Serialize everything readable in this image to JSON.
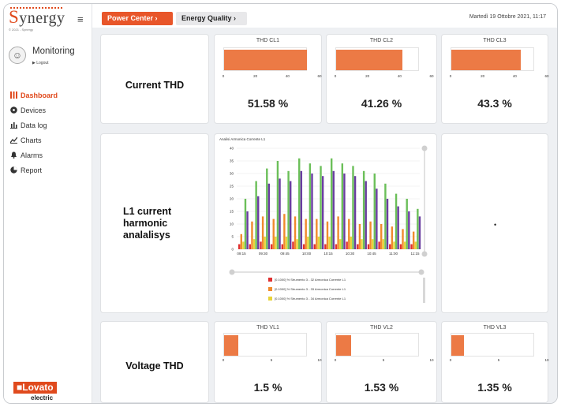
{
  "app": {
    "logo_text": "Synergy",
    "copyright": "© 2021 - Synergy",
    "menu_icon": "hamburger-icon"
  },
  "user": {
    "name": "Monitoring",
    "logout": "Logout"
  },
  "nav": [
    {
      "label": "Dashboard",
      "icon": "grid-icon",
      "active": true
    },
    {
      "label": "Devices",
      "icon": "gauge-icon",
      "active": false
    },
    {
      "label": "Data log",
      "icon": "bar-chart-icon",
      "active": false
    },
    {
      "label": "Charts",
      "icon": "line-chart-icon",
      "active": false
    },
    {
      "label": "Alarms",
      "icon": "bell-icon",
      "active": false
    },
    {
      "label": "Report",
      "icon": "pie-icon",
      "active": false
    }
  ],
  "brand": {
    "name": "Lovato",
    "sub": "electric"
  },
  "breadcrumb": {
    "first": "Power Center ›",
    "second": "Energy Quality ›"
  },
  "datetime": "Martedì 19 Ottobre 2021, 11:17",
  "sections": {
    "current_thd": "Current THD",
    "harmonic": [
      "L1 current",
      "harmonic",
      "analalisys"
    ],
    "voltage_thd": "Voltage THD",
    "placeholder_dot": "•"
  },
  "current_cards": [
    {
      "title": "THD CL1",
      "value_text": "51.58 %",
      "value": 51.58,
      "max": 60,
      "ticks": [
        "0",
        "20",
        "40",
        "60"
      ]
    },
    {
      "title": "THD CL2",
      "value_text": "41.26 %",
      "value": 41.26,
      "max": 60,
      "ticks": [
        "0",
        "20",
        "40",
        "60"
      ]
    },
    {
      "title": "THD CL3",
      "value_text": "43.3 %",
      "value": 43.3,
      "max": 60,
      "ticks": [
        "0",
        "20",
        "40",
        "60"
      ]
    }
  ],
  "voltage_cards": [
    {
      "title": "THD VL1",
      "value_text": "1.5 %",
      "value": 1.5,
      "max": 10,
      "ticks": [
        "0",
        "5",
        "10"
      ]
    },
    {
      "title": "THD VL2",
      "value_text": "1.53 %",
      "value": 1.53,
      "max": 10,
      "ticks": [
        "0",
        "5",
        "10"
      ]
    },
    {
      "title": "THD VL3",
      "value_text": "1.35 %",
      "value": 1.35,
      "max": 10,
      "ticks": [
        "0",
        "5",
        "10"
      ]
    }
  ],
  "colors": {
    "accent": "#e8562a",
    "bar": "#ec7a45"
  },
  "chart_data": {
    "type": "bar",
    "title": "Analisi Armonica Corrente L1",
    "ylim": [
      0,
      40
    ],
    "yticks": [
      "0",
      "5",
      "10",
      "15",
      "20",
      "25",
      "30",
      "35",
      "40"
    ],
    "categories": [
      "09:15",
      "09:30",
      "09:45",
      "10:00",
      "10:15",
      "10:30",
      "10:45",
      "11:00",
      "11:15"
    ],
    "series": [
      {
        "name": "[0.1000] % Strumento 3 - 32 Armonica Corrente L1",
        "color": "#e03030",
        "values": [
          2,
          2,
          3,
          2,
          2,
          3,
          2,
          2,
          2,
          2,
          3,
          2,
          2,
          3,
          2,
          2,
          2
        ]
      },
      {
        "name": "[0.1000] % Strumento 3 - 33 Armonica Corrente L1",
        "color": "#f08a2c",
        "values": [
          6,
          11,
          13,
          12,
          14,
          13,
          12,
          12,
          11,
          13,
          12,
          10,
          11,
          10,
          9,
          8,
          7
        ]
      },
      {
        "name": "[0.1000] % Strumento 3 - 34 Armonica Corrente L1",
        "color": "#e8d43a",
        "values": [
          3,
          4,
          5,
          5,
          5,
          4,
          5,
          5,
          5,
          4,
          5,
          4,
          4,
          4,
          3,
          3,
          3
        ]
      },
      {
        "name": "",
        "color": "#6bbf59",
        "values": [
          20,
          27,
          32,
          35,
          31,
          36,
          34,
          33,
          36,
          34,
          33,
          31,
          30,
          26,
          22,
          20,
          16
        ]
      },
      {
        "name": "",
        "color": "#6a3da1",
        "values": [
          15,
          21,
          26,
          28,
          27,
          31,
          30,
          29,
          31,
          30,
          29,
          27,
          24,
          20,
          17,
          15,
          13
        ]
      }
    ],
    "legend_visible": [
      0,
      1,
      2
    ]
  }
}
